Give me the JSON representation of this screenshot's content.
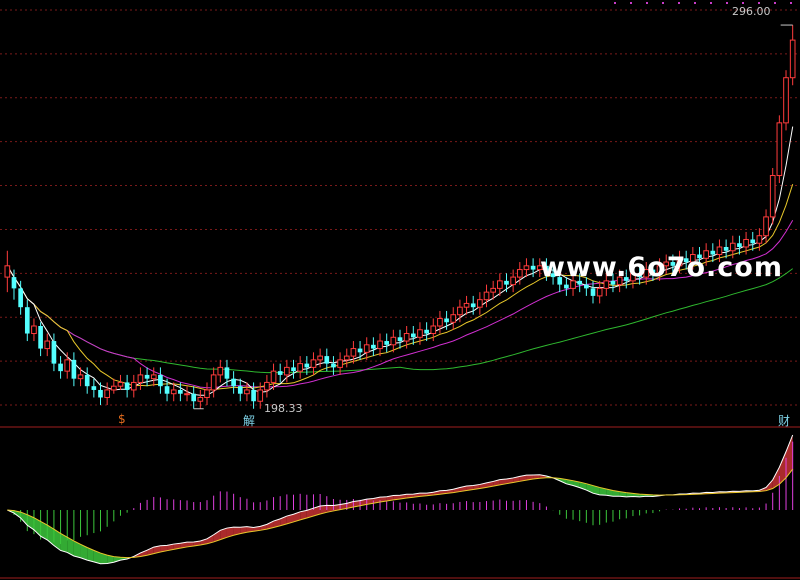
{
  "chart_data": {
    "type": "candlestick",
    "price_range": [
      195,
      300
    ],
    "annotations": {
      "high_label": "296.00",
      "low_label": "198.33"
    },
    "event_markers": [
      {
        "text": "$",
        "index": 18,
        "color": "#e46c1e"
      },
      {
        "text": "解",
        "index": 38,
        "color": "#7fd3e8"
      },
      {
        "text": "财",
        "index": 120,
        "color": "#7fd3e8"
      }
    ],
    "watermark": "www.6o7o.com",
    "candles": [
      [
        229.0,
        232.0,
        225.0,
        236.0
      ],
      [
        229.0,
        226.0,
        223.0,
        231.0
      ],
      [
        226.0,
        221.0,
        219.0,
        228.0
      ],
      [
        221.0,
        214.0,
        212.0,
        223.0
      ],
      [
        214.0,
        216.0,
        212.0,
        218.0
      ],
      [
        216.0,
        210.0,
        208.0,
        217.0
      ],
      [
        210.0,
        212.0,
        208.0,
        214.0
      ],
      [
        212.0,
        206.0,
        204.0,
        214.0
      ],
      [
        206.0,
        204.0,
        202.0,
        208.0
      ],
      [
        204.0,
        207.0,
        202.0,
        209.0
      ],
      [
        207.0,
        202.0,
        200.0,
        209.0
      ],
      [
        202.0,
        203.0,
        200.0,
        205.0
      ],
      [
        203.0,
        200.0,
        198.0,
        205.0
      ],
      [
        200.0,
        199.0,
        197.0,
        202.0
      ],
      [
        199.0,
        197.0,
        195.0,
        201.0
      ],
      [
        197.0,
        199.0,
        195.0,
        201.0
      ],
      [
        199.0,
        200.0,
        198.0,
        202.0
      ],
      [
        200.0,
        201.0,
        199.0,
        203.0
      ],
      [
        201.0,
        199.0,
        197.0,
        203.0
      ],
      [
        199.0,
        201.0,
        197.0,
        203.0
      ],
      [
        201.0,
        203.0,
        199.0,
        205.0
      ],
      [
        203.0,
        202.0,
        200.0,
        205.0
      ],
      [
        202.0,
        203.0,
        200.0,
        205.0
      ],
      [
        203.0,
        200.0,
        198.0,
        205.0
      ],
      [
        200.0,
        198.0,
        196.0,
        202.0
      ],
      [
        198.0,
        199.0,
        196.0,
        201.0
      ],
      [
        199.0,
        198.0,
        196.0,
        201.0
      ],
      [
        198.0,
        198.0,
        196.0,
        200.0
      ],
      [
        198.0,
        196.0,
        194.0,
        200.0
      ],
      [
        196.0,
        197.0,
        194.0,
        199.0
      ],
      [
        197.0,
        199.0,
        195.0,
        201.0
      ],
      [
        199.0,
        203.0,
        197.0,
        205.0
      ],
      [
        203.0,
        205.0,
        201.0,
        207.0
      ],
      [
        205.0,
        202.0,
        200.0,
        207.0
      ],
      [
        202.0,
        200.0,
        198.0,
        204.0
      ],
      [
        200.0,
        198.0,
        196.0,
        202.0
      ],
      [
        198.0,
        199.0,
        196.0,
        201.0
      ],
      [
        199.0,
        196.0,
        194.0,
        201.0
      ],
      [
        196.0,
        199.0,
        194.0,
        201.0
      ],
      [
        199.0,
        201.0,
        197.0,
        203.0
      ],
      [
        201.0,
        204.0,
        199.0,
        206.0
      ],
      [
        204.0,
        203.0,
        201.0,
        206.0
      ],
      [
        203.0,
        205.0,
        201.0,
        207.0
      ],
      [
        205.0,
        204.0,
        202.0,
        207.0
      ],
      [
        204.0,
        206.0,
        202.0,
        208.0
      ],
      [
        206.0,
        205.0,
        203.0,
        208.0
      ],
      [
        205.0,
        207.0,
        203.0,
        209.0
      ],
      [
        207.0,
        208.0,
        205.0,
        210.0
      ],
      [
        208.0,
        206.0,
        204.0,
        210.0
      ],
      [
        206.0,
        205.0,
        203.0,
        208.0
      ],
      [
        205.0,
        207.0,
        203.0,
        209.0
      ],
      [
        207.0,
        208.0,
        205.0,
        210.0
      ],
      [
        208.0,
        210.0,
        206.0,
        212.0
      ],
      [
        210.0,
        209.0,
        207.0,
        212.0
      ],
      [
        209.0,
        211.0,
        207.0,
        213.0
      ],
      [
        211.0,
        210.0,
        208.0,
        213.0
      ],
      [
        210.0,
        212.0,
        208.0,
        214.0
      ],
      [
        212.0,
        211.0,
        209.0,
        214.0
      ],
      [
        211.0,
        213.0,
        209.0,
        215.0
      ],
      [
        213.0,
        212.0,
        210.0,
        215.0
      ],
      [
        212.0,
        214.0,
        210.0,
        216.0
      ],
      [
        214.0,
        213.0,
        211.0,
        216.0
      ],
      [
        213.0,
        215.0,
        211.0,
        217.0
      ],
      [
        215.0,
        214.0,
        212.0,
        217.0
      ],
      [
        214.0,
        216.0,
        212.0,
        218.0
      ],
      [
        216.0,
        218.0,
        214.0,
        220.0
      ],
      [
        218.0,
        217.0,
        215.0,
        220.0
      ],
      [
        217.0,
        219.0,
        215.0,
        221.0
      ],
      [
        219.0,
        221.0,
        217.0,
        223.0
      ],
      [
        221.0,
        222.0,
        219.0,
        224.0
      ],
      [
        222.0,
        221.0,
        219.0,
        224.0
      ],
      [
        221.0,
        223.0,
        219.0,
        225.0
      ],
      [
        223.0,
        225.0,
        221.0,
        227.0
      ],
      [
        225.0,
        226.0,
        223.0,
        228.0
      ],
      [
        226.0,
        228.0,
        224.0,
        230.0
      ],
      [
        228.0,
        227.0,
        225.0,
        230.0
      ],
      [
        227.0,
        229.0,
        225.0,
        231.0
      ],
      [
        229.0,
        231.0,
        227.0,
        233.0
      ],
      [
        231.0,
        232.0,
        229.0,
        234.0
      ],
      [
        232.0,
        231.0,
        229.0,
        234.0
      ],
      [
        231.0,
        232.0,
        229.0,
        234.0
      ],
      [
        232.0,
        230.0,
        228.0,
        234.0
      ],
      [
        230.0,
        229.0,
        227.0,
        232.0
      ],
      [
        229.0,
        227.0,
        225.0,
        231.0
      ],
      [
        227.0,
        226.0,
        224.0,
        229.0
      ],
      [
        226.0,
        228.0,
        224.0,
        230.0
      ],
      [
        228.0,
        227.0,
        225.0,
        230.0
      ],
      [
        227.0,
        226.0,
        224.0,
        229.0
      ],
      [
        226.0,
        224.0,
        222.0,
        228.0
      ],
      [
        224.0,
        226.0,
        222.0,
        228.0
      ],
      [
        226.0,
        228.0,
        224.0,
        230.0
      ],
      [
        228.0,
        227.0,
        225.0,
        230.0
      ],
      [
        227.0,
        229.0,
        225.0,
        231.0
      ],
      [
        229.0,
        228.0,
        226.0,
        231.0
      ],
      [
        228.0,
        230.0,
        226.0,
        232.0
      ],
      [
        230.0,
        229.0,
        227.0,
        232.0
      ],
      [
        229.0,
        231.0,
        227.0,
        233.0
      ],
      [
        231.0,
        230.0,
        228.0,
        233.0
      ],
      [
        230.0,
        232.0,
        228.0,
        234.0
      ],
      [
        232.0,
        233.0,
        230.0,
        235.0
      ],
      [
        233.0,
        232.0,
        230.0,
        235.0
      ],
      [
        232.0,
        234.0,
        230.0,
        236.0
      ],
      [
        234.0,
        233.0,
        231.0,
        236.0
      ],
      [
        233.0,
        235.0,
        231.0,
        237.0
      ],
      [
        235.0,
        234.0,
        232.0,
        237.0
      ],
      [
        234.0,
        236.0,
        232.0,
        238.0
      ],
      [
        236.0,
        235.0,
        233.0,
        238.0
      ],
      [
        235.0,
        237.0,
        233.0,
        239.0
      ],
      [
        237.0,
        236.0,
        234.0,
        239.0
      ],
      [
        236.0,
        238.0,
        234.0,
        240.0
      ],
      [
        238.0,
        237.0,
        235.0,
        240.0
      ],
      [
        237.0,
        239.0,
        235.0,
        241.0
      ],
      [
        239.0,
        238.0,
        236.0,
        241.0
      ],
      [
        238.0,
        240.0,
        236.0,
        242.0
      ],
      [
        240.0,
        245.0,
        238.0,
        247.0
      ],
      [
        245.0,
        256.0,
        243.0,
        258.0
      ],
      [
        256.0,
        270.0,
        254.0,
        272.0
      ],
      [
        270.0,
        282.0,
        268.0,
        284.0
      ],
      [
        282.0,
        292.0,
        280.0,
        296.0
      ]
    ]
  }
}
